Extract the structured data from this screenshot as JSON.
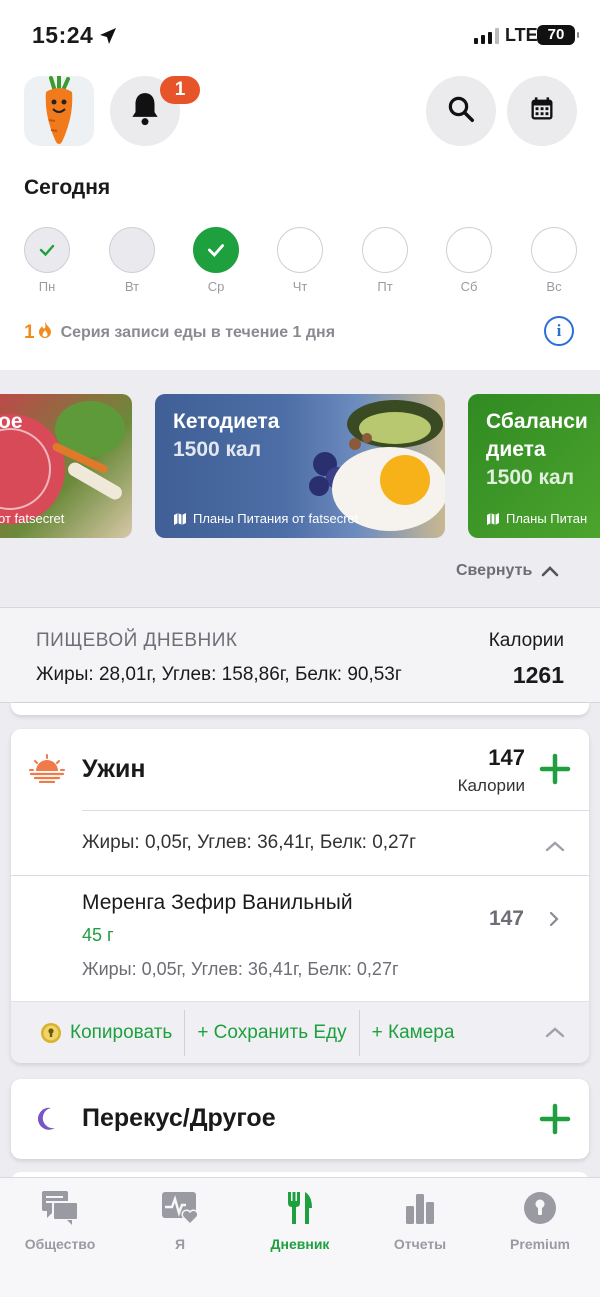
{
  "status_bar": {
    "time": "15:24",
    "network": "LTE",
    "battery": "70"
  },
  "header": {
    "notifications_badge": "1",
    "today_label": "Сегодня",
    "week_days": [
      {
        "label": "Пн",
        "state": "done"
      },
      {
        "label": "Вт",
        "state": "empty"
      },
      {
        "label": "Ср",
        "state": "today"
      },
      {
        "label": "Чт",
        "state": "future"
      },
      {
        "label": "Пт",
        "state": "future"
      },
      {
        "label": "Сб",
        "state": "future"
      },
      {
        "label": "Вс",
        "state": "future"
      }
    ],
    "streak_count": "1",
    "streak_text": "Серия записи еды в течение 1 дня"
  },
  "plans": [
    {
      "title": "ое",
      "calories": "",
      "footer": "от fatsecret"
    },
    {
      "title": "Кетодиета",
      "calories": "1500 кал",
      "footer": "Планы Питания от fatsecret"
    },
    {
      "title": "Сбаланси диета",
      "calories": "1500 кал",
      "footer": "Планы Питан"
    }
  ],
  "collapse_label": "Свернуть",
  "diary": {
    "heading": "ПИЩЕВОЙ ДНЕВНИК",
    "macros": "Жиры: 28,01г, Углев: 158,86г, Белк: 90,53г",
    "calories_label": "Калории",
    "calories_value": "1261"
  },
  "meal": {
    "name": "Ужин",
    "calories": "147",
    "calories_label": "Калории",
    "macros": "Жиры: 0,05г, Углев: 36,41г, Белк: 0,27г",
    "food": {
      "name": "Меренга Зефир Ванильный",
      "quantity": "45 г",
      "macros": "Жиры: 0,05г, Углев: 36,41г, Белк: 0,27г",
      "calories": "147"
    },
    "actions": {
      "copy": "Копировать",
      "save": "+ Сохранить Еду",
      "camera": "+ Камера"
    }
  },
  "snack": {
    "name": "Перекус/Другое"
  },
  "tabs": [
    {
      "label": "Общество",
      "icon": "chat-icon"
    },
    {
      "label": "Я",
      "icon": "health-icon"
    },
    {
      "label": "Дневник",
      "icon": "fork-knife-icon"
    },
    {
      "label": "Отчеты",
      "icon": "bar-chart-icon"
    },
    {
      "label": "Premium",
      "icon": "lock-icon"
    }
  ],
  "colors": {
    "accent": "#1fa03f",
    "badge": "#e8542a",
    "info": "#2a6fd6",
    "streak": "#f08c1e"
  }
}
